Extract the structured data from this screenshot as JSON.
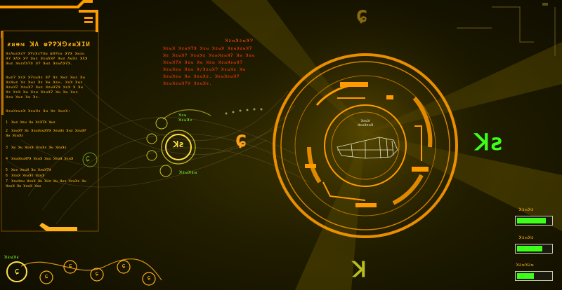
{
  "colors": {
    "accent": "#ffa114",
    "alert": "#ff3a14",
    "ok": "#3cff1a",
    "bg": "#161300"
  },
  "left_panel": {
    "title": "ƨᴎɘᴍ ꓘɅ ⱷɁɁꓘ⅁ƨᴎꓘIИ",
    "para1": [
      "ꓘƨɅᴍƨꓘƨɁ ꓘɁƨꓘƨɁꓘᴍ ⱷꓘɁƨᴍ ꓘɁꓘ ꓘᴍƨᴎ",
      "ꓘɁ ꓘɅꓘ ꓘɁ ꓘᴍƨ ꓘƨᴍɅꓘɁ ꓘᴍƨ Ʌᴍꓘƨ ꓘɅꓘ",
      "ꓘᴍƨ ꓘᴍƨɅꓘɁꓘ ꓘɁ ꓘᴍƨ ꓘƨᴍɅꓘɁꓘ."
    ],
    "para2": [
      "ꓘᴍƨɁ ꓘƨꓘ ꓘɁƨᴍꓘƨ ꓘɁ ꓘƨ ꓘᴍƨ ꓘᴍƨ ꓘᴍ",
      "ꓘƨꓘᴍƨ ꓘƨ ꓘᴍƨ ꓘƨ ꓘᴍ ꓘƨᴍ. ꓘƨꓘ ꓘᴍƨ",
      "ꓘƨᴍꓘɁ ꓘƨᴍꓘɁ ꓘᴍƨ ꓘƨᴍꓘɁꓘ ꓘƨꓘ ꓘ ꓘᴍ",
      "ꓘƨ ꓘƨꓘ ꓘᴍ ꓘƨᴍ ꓘƨᴍꓘɁ ꓘᴍ ꓘᴍ ꓘᴍƨ",
      "ꓘƨᴍ ꓘᴍƨ ꓘᴍ ꓘƨ."
    ],
    "para3": "ꓘƨᴍꓘƨᴍƨꓘ ꓘƨᴍꓘƨ ꓘᴍ ꓘƨ ꓘᴍƨꓘ:",
    "list": [
      {
        "num": "1",
        "text": "ꓘᴍƨ ꓘƨᴍ ꓘᴍ ꓘƨꓘɁꓘ ꓘᴍƨ"
      },
      {
        "num": "2",
        "text": "ꓘƨᴍꓘɁ ꓘƨ ꓘƨᴍꓘƨᴍꓘɁꓘ ꓘƨᴍꓘƨ ꓘᴍƨ ꓘƨᴍꓘɁ ꓘᴍ ꓘƨᴍꓘƨ"
      },
      {
        "num": "3",
        "text": "ꓘᴍ ꓘᴍ ꓘƨᴍꓘ ꓘƨᴍꓘƨ ꓘᴍ ꓘƨᴍꓘƨ"
      },
      {
        "num": "4",
        "text": "ꓘƨᴍꓘƨᴍꓘɁꓘ ꓘƨᴍꓘ ꓘᴍƨ ꓘƨᴍꓘ ꓘƨᴍꓘ"
      },
      {
        "num": "5",
        "text": "ꓘᴍƨ ꓘƨᴍꓘ ꓘᴍ ꓘƨᴍꓘɁꓘ"
      },
      {
        "num": "6",
        "text": "ꓘƨᴍꓘ ꓘƨᴍꓘƨ ꓘƨᴍꓘ"
      },
      {
        "num": "7",
        "text": "ꓘƨᴍꓘƨᴍ ꓘƨᴍꓘ ꓘᴍ ꓘᴍƨ ꓘᴍ ꓘᴍƨ ꓘƨᴍꓘƨ ꓘᴍ ꓘƨᴍꓘ ꓘᴍ ꓘƨᴍꓘ ꓘƨᴍ"
      }
    ]
  },
  "center_text": {
    "heading": "ꓘƨᴍꓘƨᴍꓘɁ",
    "lines": [
      "ꓘƨᴍꓘ ꓘƨᴍꓘɁꓘ ꓘƨᴍ ꓘƨᴍꓘ ꓘƨᴍꓘƨᴍꓘɁ",
      "ꓘƨ ꓘƨᴍꓘɁ ꓘƨᴍꓘƨ ꓘƨᴍꓘƨᴍꓘɁ ꓘᴍ ꓘƨᴍ",
      "ꓘƨᴍꓘɁꓘ ꓘƨᴍ ꓘᴍ ꓘƨᴍ ꓘƨᴍꓘƨᴍꓘɁ",
      "ꓘƨᴍꓘƨᴍ ꓘƨᴍ ꓘ/ꓘƨᴍꓘɁ ꓘƨᴍꓘƨ ꓘᴍ",
      "ꓘƨᴍꓘƨᴍ ꓘᴍ ꓘƨᴍꓘƨ. ꓘƨᴍꓘƨᴍꓘɁ",
      "ꓘƨᴍꓘƨᴍꓘɁꓘ ꓘƨᴍꓘƨ."
    ]
  },
  "mini_dial": {
    "label": "ꓘƨᴍ\nꓘƨᴍꓘƨ",
    "sub": "ꓘƨᴍꓘƨᴍ",
    "glyph": "ꓘƨ"
  },
  "core": {
    "label": "ꓘƨᴍꓘ\nꓘƨᴍꓘƨᴍꓘ"
  },
  "glyphs": {
    "top_center": "ɕ",
    "left_mid": "ɕ",
    "right_big": "ꓘƨ",
    "bottom_center": "ꓘ",
    "left_small": "ɕ"
  },
  "bottom_nav": {
    "title": "ꓘƨᴍꓘƨ",
    "items": [
      "ɕ",
      "ɕ",
      "ɕ",
      "ɕ",
      "ɕ",
      "ɕ"
    ]
  },
  "status": [
    {
      "label": "ꓘƨᴍꓘƨ",
      "fill": 0.85
    },
    {
      "label": "ꓘƨᴍꓘƨ",
      "fill": 0.75
    },
    {
      "label": "ꓘƨᴍꓘƨᴍ",
      "fill": 0.5
    }
  ]
}
